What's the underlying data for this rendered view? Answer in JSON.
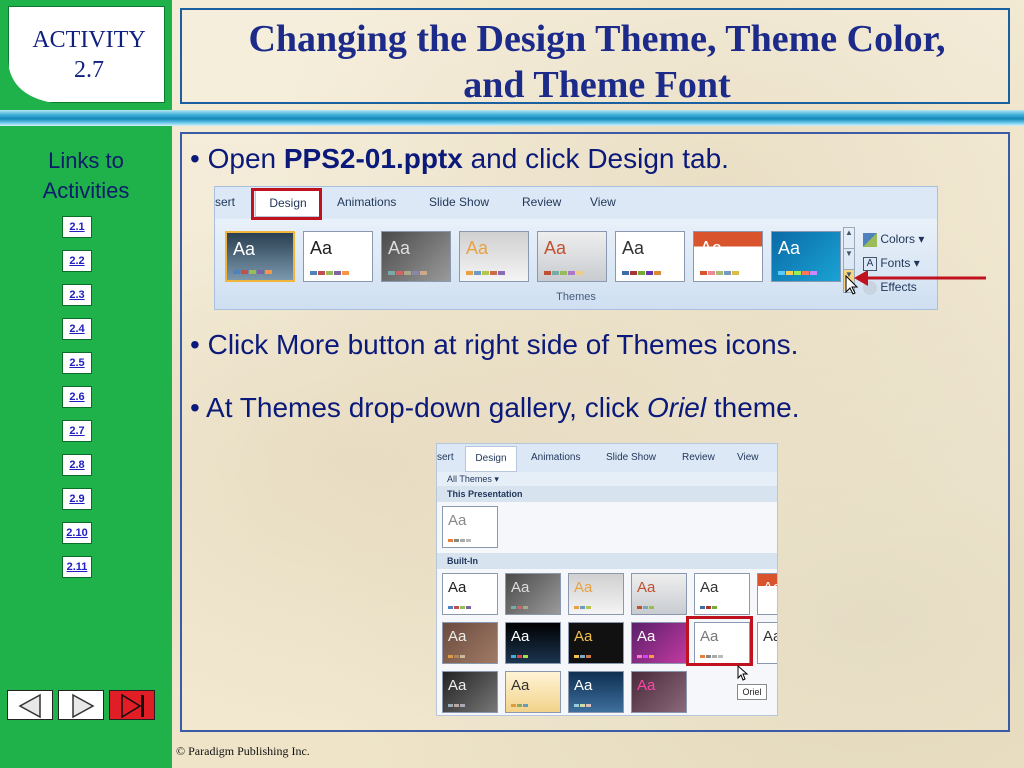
{
  "activity": {
    "label": "ACTIVITY",
    "number": "2.7"
  },
  "title": {
    "line1": "Changing the Design Theme, Theme Color,",
    "line2": "and Theme Font"
  },
  "sidebar": {
    "links_title_line1": "Links to",
    "links_title_line2": "Activities",
    "links": [
      "2.1",
      "2.2",
      "2.3",
      "2.4",
      "2.5",
      "2.6",
      "2.7",
      "2.8",
      "2.9",
      "2.10",
      "2.11"
    ]
  },
  "bullets": {
    "b1": {
      "prefix": "Open ",
      "bold": "PPS2-01.pptx",
      "suffix": " and click Design tab."
    },
    "b2": {
      "text": "Click More button at right side of Themes icons."
    },
    "b3": {
      "prefix": "At Themes drop-down gallery, click ",
      "italic": "Oriel",
      "suffix": " theme."
    }
  },
  "ribbon": {
    "tabs": [
      "sert",
      "Design",
      "Animations",
      "Slide Show",
      "Review",
      "View"
    ],
    "thumb_text": "Aa",
    "options": [
      "Colors",
      "Fonts",
      "Effects"
    ],
    "group_label": "Themes"
  },
  "gallery": {
    "tabs": [
      "sert",
      "Design",
      "Animations",
      "Slide Show",
      "Review",
      "View"
    ],
    "all_themes": "All Themes",
    "this_presentation": "This Presentation",
    "built_in": "Built-In",
    "tooltip": "Oriel"
  },
  "footer": {
    "copyright": "© Paradigm Publishing Inc."
  },
  "colors": {
    "sidebar": "#1fb24a",
    "title": "#1c2a8a",
    "bullet": "#0b1a7a",
    "highlight": "#c0121e"
  }
}
